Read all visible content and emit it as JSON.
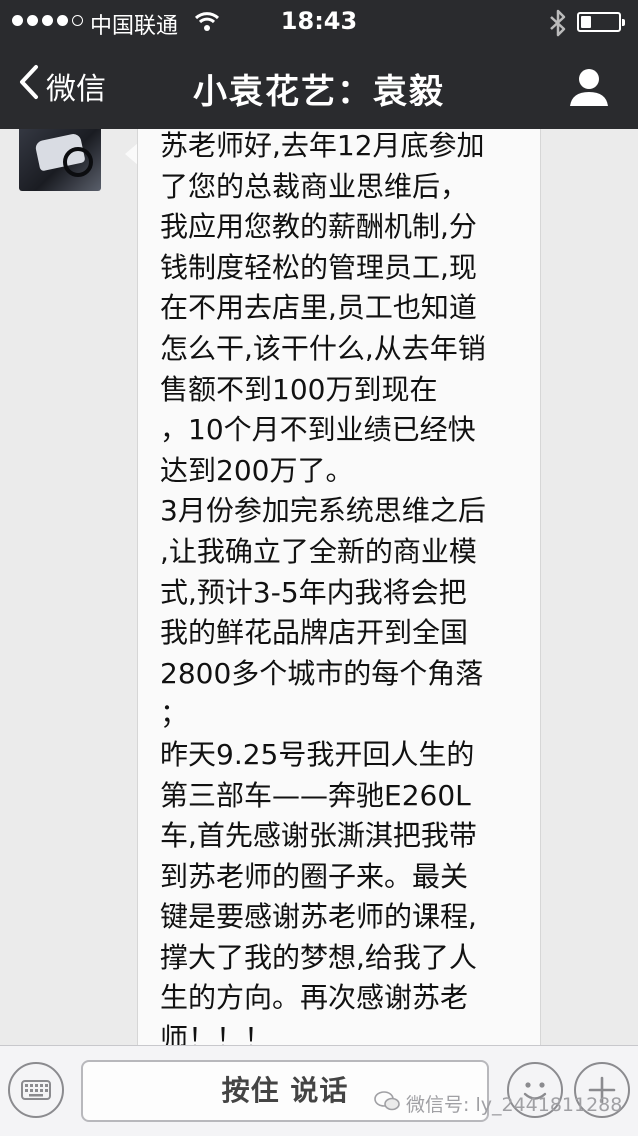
{
  "status_bar": {
    "carrier": "中国联通",
    "time": "18:43",
    "signal_bars_filled": 4,
    "signal_bars_total": 5,
    "battery_level": 0.2
  },
  "nav": {
    "back_label": "微信",
    "title": "小袁花艺：袁毅"
  },
  "message": {
    "lines": [
      "苏老师好,去年12月底参加",
      "了您的总裁商业思维后，",
      "我应用您教的薪酬机制,分",
      "钱制度轻松的管理员工,现",
      "在不用去店里,员工也知道",
      "怎么干,该干什么,从去年销",
      "售额不到100万到现在",
      "，10个月不到业绩已经快",
      "达到200万了。",
      "3月份参加完系统思维之后",
      ",让我确立了全新的商业模",
      "式,预计3-5年内我将会把",
      "我的鲜花品牌店开到全国",
      "2800多个城市的每个角落",
      "；",
      "昨天9.25号我开回人生的",
      "第三部车——奔驰E260L",
      "车,首先感谢张澌淇把我带",
      "到苏老师的圈子来。最关",
      "键是要感谢苏老师的课程,",
      "撑大了我的梦想,给我了人",
      "生的方向。再次感谢苏老",
      "师！！！"
    ]
  },
  "input_bar": {
    "hold_to_talk_label": "按住 说话",
    "watermark": "微信号: ly_2441811288"
  },
  "colors": {
    "header_bg": "#2a2b2e",
    "chat_bg": "#ebebeb",
    "bubble_bg": "#fafafa"
  },
  "icons": [
    "wifi-icon",
    "bluetooth-icon",
    "battery-icon",
    "back-chevron-icon",
    "profile-icon",
    "keyboard-icon",
    "emoji-icon",
    "plus-icon",
    "wechat-logo-icon"
  ]
}
